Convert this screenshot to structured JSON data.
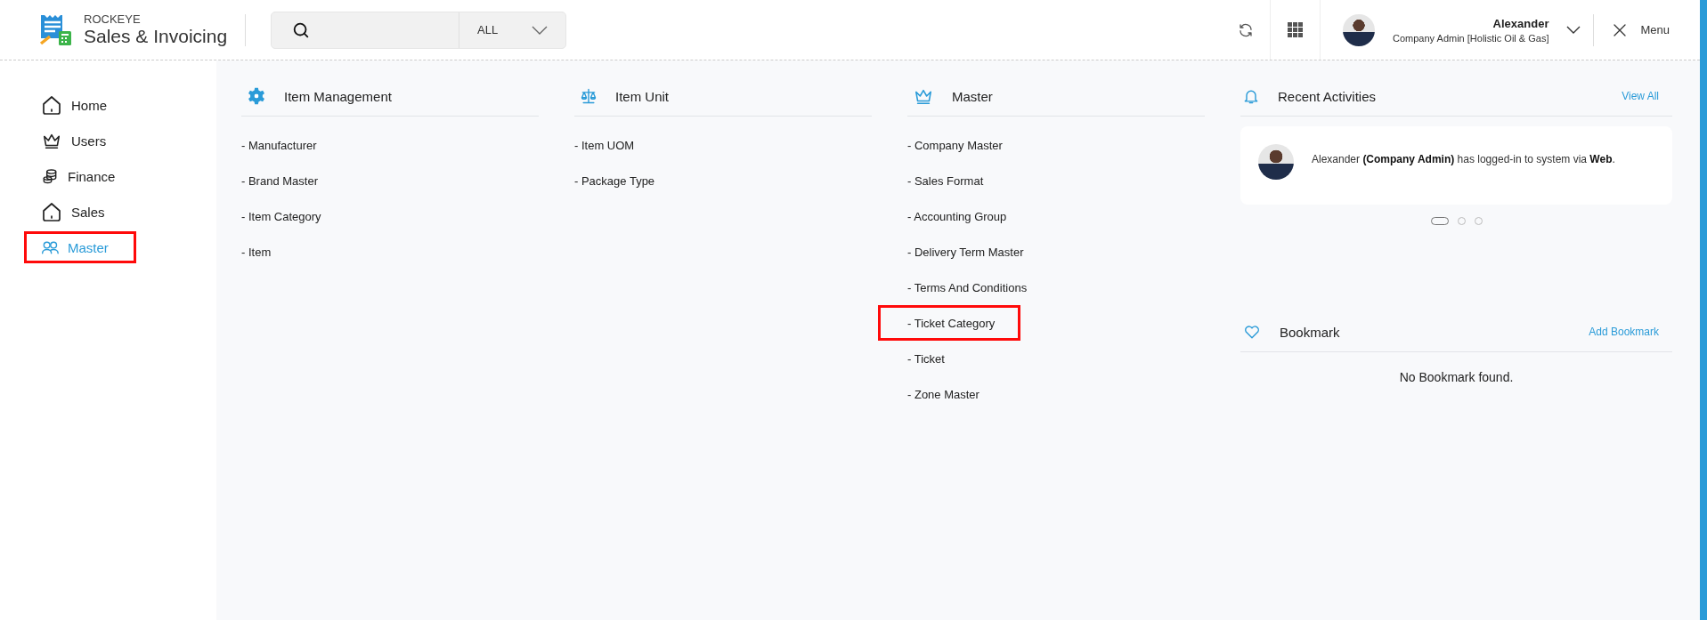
{
  "header": {
    "brand_top": "ROCKEYE",
    "brand_name": "Sales & Invoicing",
    "search": {
      "scope": "ALL"
    },
    "user": {
      "name": "Alexander",
      "role": "Company Admin [Holistic Oil & Gas]"
    },
    "menu_label": "Menu"
  },
  "sidebar": {
    "items": [
      {
        "label": "Home",
        "kind": "home",
        "selected": false,
        "highlighted": false
      },
      {
        "label": "Users",
        "kind": "users",
        "selected": false,
        "highlighted": false
      },
      {
        "label": "Finance",
        "kind": "finance",
        "selected": false,
        "highlighted": false
      },
      {
        "label": "Sales",
        "kind": "sales",
        "selected": false,
        "highlighted": false
      },
      {
        "label": "Master",
        "kind": "master",
        "selected": true,
        "highlighted": true
      }
    ]
  },
  "menu_groups": [
    {
      "title": "Item Management",
      "kind": "items",
      "items": [
        {
          "label": "- Manufacturer",
          "highlighted": false
        },
        {
          "label": "- Brand Master",
          "highlighted": false
        },
        {
          "label": "- Item Category",
          "highlighted": false
        },
        {
          "label": "- Item",
          "highlighted": false
        }
      ]
    },
    {
      "title": "Item Unit",
      "kind": "units",
      "items": [
        {
          "label": "- Item UOM",
          "highlighted": false
        },
        {
          "label": "- Package Type",
          "highlighted": false
        }
      ]
    },
    {
      "title": "Master",
      "kind": "master",
      "items": [
        {
          "label": "- Company Master",
          "highlighted": false
        },
        {
          "label": "- Sales Format",
          "highlighted": false
        },
        {
          "label": "- Accounting Group",
          "highlighted": false
        },
        {
          "label": "- Delivery Term Master",
          "highlighted": false
        },
        {
          "label": "- Terms And Conditions",
          "highlighted": false
        },
        {
          "label": "- Ticket Category",
          "highlighted": true
        },
        {
          "label": "- Ticket",
          "highlighted": false
        },
        {
          "label": "- Zone Master",
          "highlighted": false
        }
      ]
    }
  ],
  "recent_activities": {
    "title": "Recent Activities",
    "link": "View All",
    "activity": "Alexander **(Company Admin)** has logged-in to system via **Web**.",
    "dots": [
      {
        "selected": true
      },
      {
        "selected": false
      },
      {
        "selected": false
      }
    ]
  },
  "bookmark": {
    "title": "Bookmark",
    "link": "Add Bookmark",
    "empty": "No Bookmark found."
  }
}
